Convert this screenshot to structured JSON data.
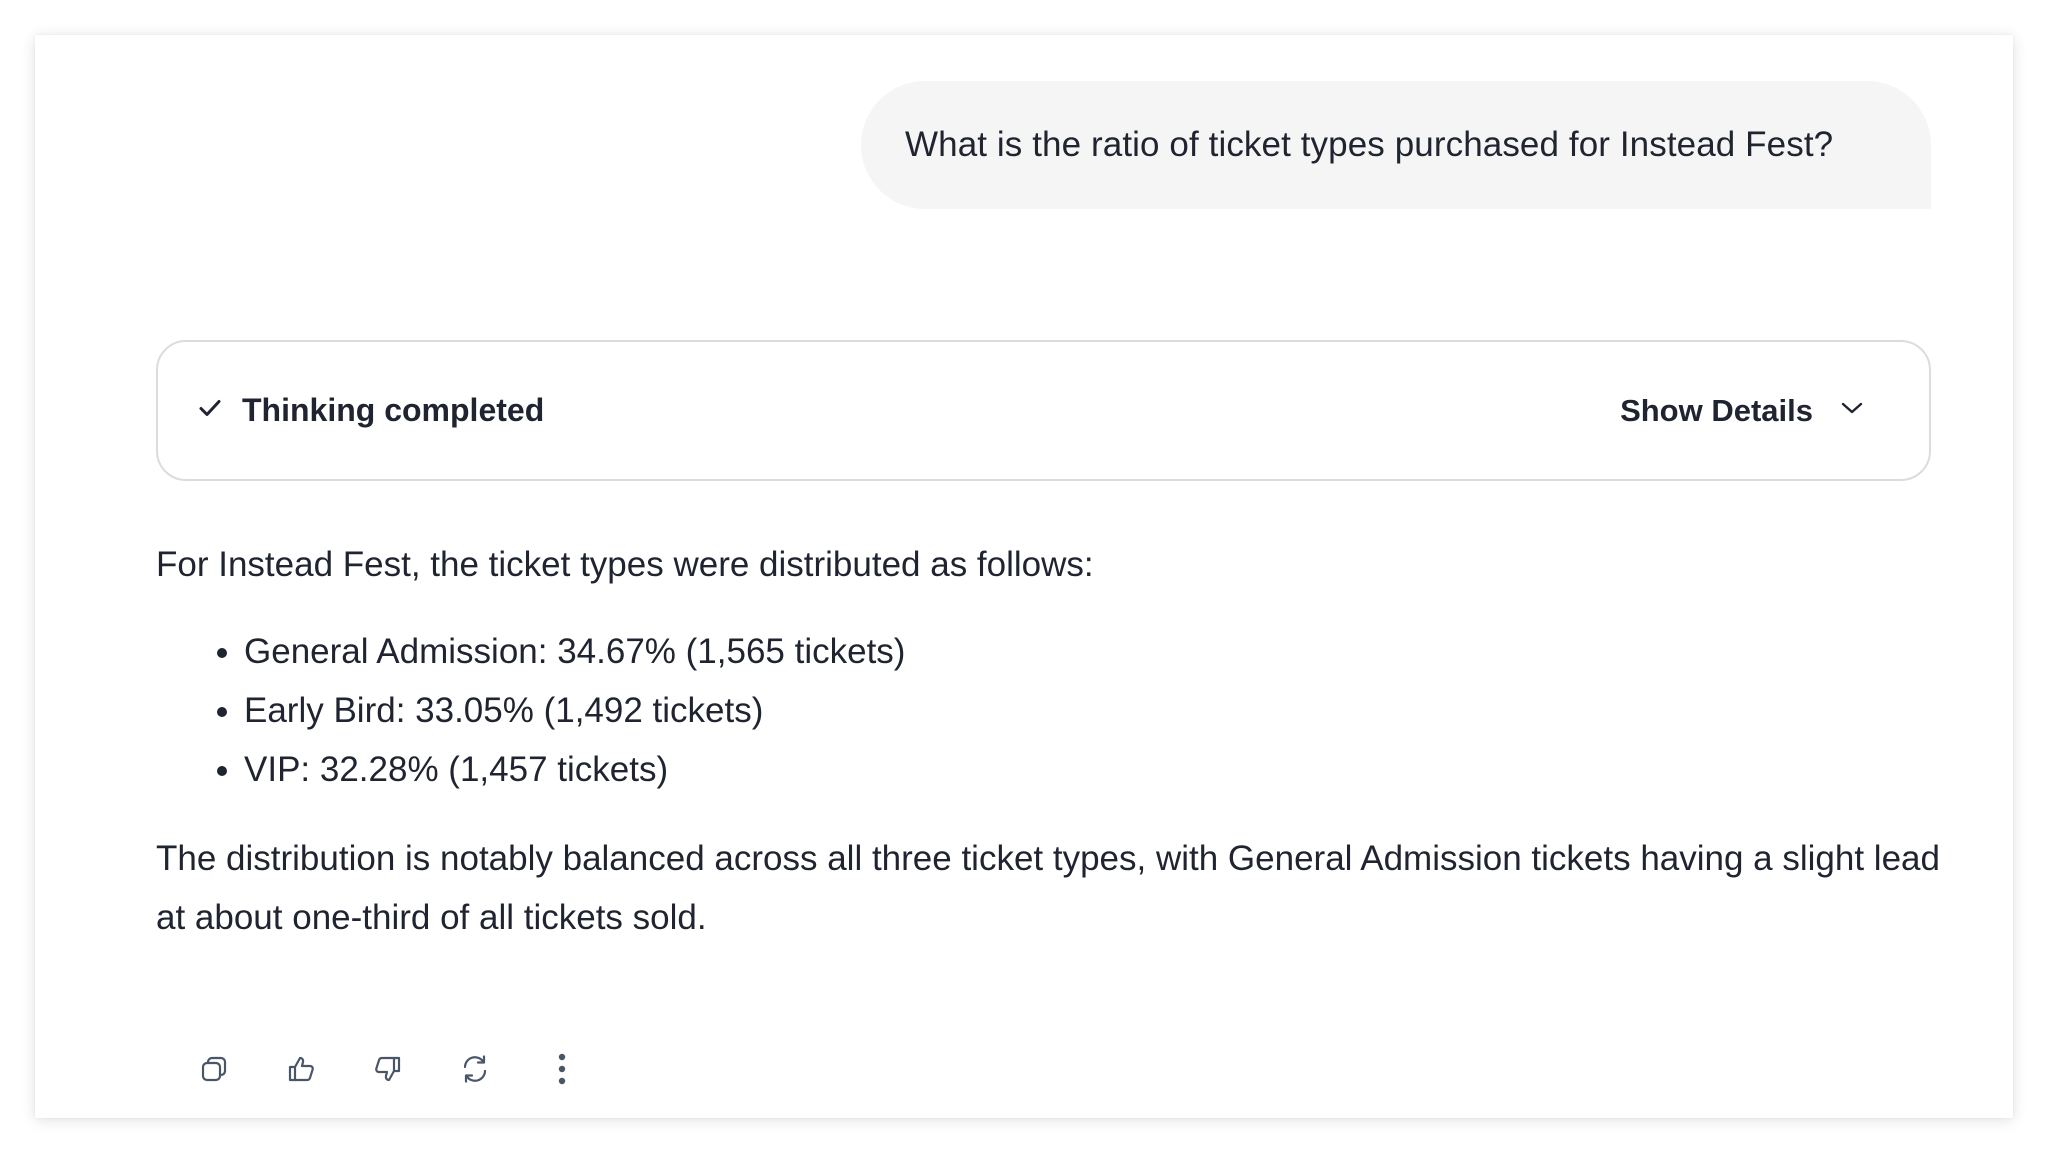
{
  "user_message": {
    "text": "What is the ratio of ticket types purchased for Instead Fest?"
  },
  "thinking": {
    "status_icon": "check-icon",
    "label": "Thinking completed",
    "toggle_label": "Show Details",
    "toggle_icon": "chevron-down-icon"
  },
  "answer": {
    "intro": "For Instead Fest, the ticket types were distributed as follows:",
    "items": [
      "General Admission: 34.67% (1,565 tickets)",
      "Early Bird: 33.05% (1,492 tickets)",
      "VIP: 32.28% (1,457 tickets)"
    ],
    "conclusion": "The distribution is notably balanced across all three ticket types, with General Admission tickets having a slight lead at about one-third of all tickets sold."
  },
  "actions": [
    {
      "icon": "copy-icon"
    },
    {
      "icon": "thumbs-up-icon"
    },
    {
      "icon": "thumbs-down-icon"
    },
    {
      "icon": "regenerate-icon"
    },
    {
      "icon": "more-options-icon"
    }
  ],
  "colors": {
    "text": "#1f2430",
    "bubble_bg": "#f5f5f5",
    "border": "#dcdcdc",
    "icon": "#4a5568"
  }
}
